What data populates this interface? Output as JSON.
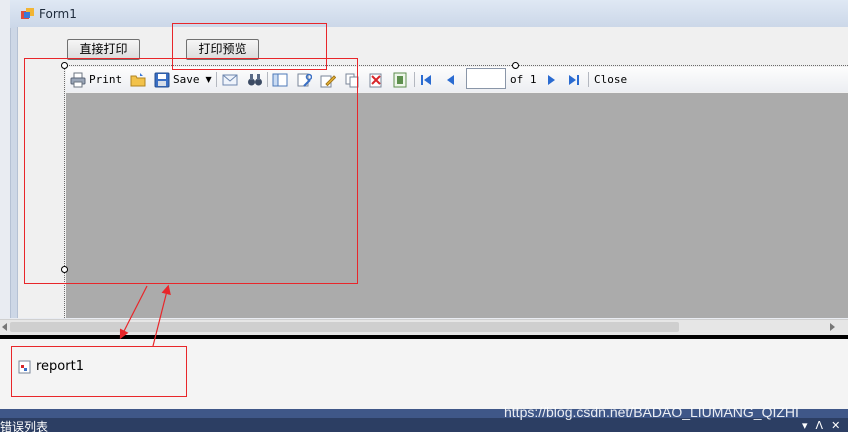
{
  "form": {
    "title": "Form1",
    "buttons": {
      "direct_print": "直接打印",
      "print_preview": "打印预览"
    }
  },
  "report_viewer": {
    "toolbar": {
      "print": "Print",
      "save": "Save",
      "page_value": "",
      "of_label": "of 1",
      "close": "Close"
    }
  },
  "tray": {
    "component": "report1"
  },
  "bottom_panel": {
    "title": "错误列表",
    "controls": [
      "▾",
      "ᐱ",
      "✕"
    ]
  },
  "watermark": "https://blog.csdn.net/BADAO_LIUMANG_QIZHI",
  "colors": {
    "annotation": "#e8262a",
    "viewer_background": "#ababab",
    "accent_blue": "#2a6bd1"
  }
}
